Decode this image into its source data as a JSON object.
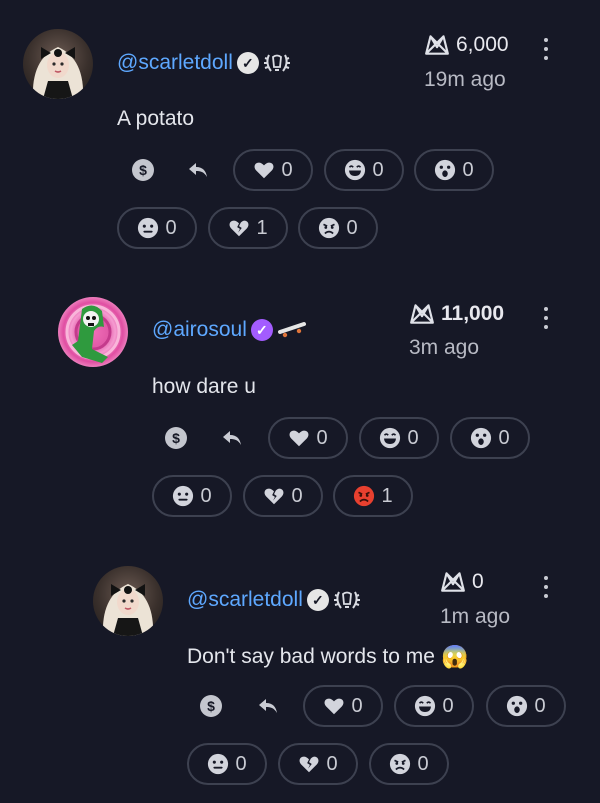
{
  "comments": [
    {
      "username": "@scarletdoll",
      "badge": "verified-check-grey",
      "emblem": "laurel-emblem",
      "score": "6,000",
      "time": "19m ago",
      "text": "A potato",
      "reactions": {
        "heart": "0",
        "grin": "0",
        "surprised": "0",
        "neutral": "0",
        "broken_heart": "1",
        "angry": "0"
      }
    },
    {
      "username": "@airosoul",
      "badge": "verified-check-purple",
      "emblem": "skateboard-emblem",
      "score": "11,000",
      "time": "3m ago",
      "text": "how dare u",
      "reactions": {
        "heart": "0",
        "grin": "0",
        "surprised": "0",
        "neutral": "0",
        "broken_heart": "0",
        "angry": "1"
      }
    },
    {
      "username": "@scarletdoll",
      "badge": "verified-check-grey",
      "emblem": "laurel-emblem",
      "score": "0",
      "time": "1m ago",
      "text": "Don't say bad words to me",
      "text_emoji": "😱",
      "reactions": {
        "heart": "0",
        "grin": "0",
        "surprised": "0",
        "neutral": "0",
        "broken_heart": "0",
        "angry": "0"
      }
    }
  ],
  "colors": {
    "background": "#161826",
    "username": "#5ea8ff",
    "pill_border": "#3d4150",
    "angry_active": "#e8402f",
    "verified_purple": "#a35cff"
  }
}
